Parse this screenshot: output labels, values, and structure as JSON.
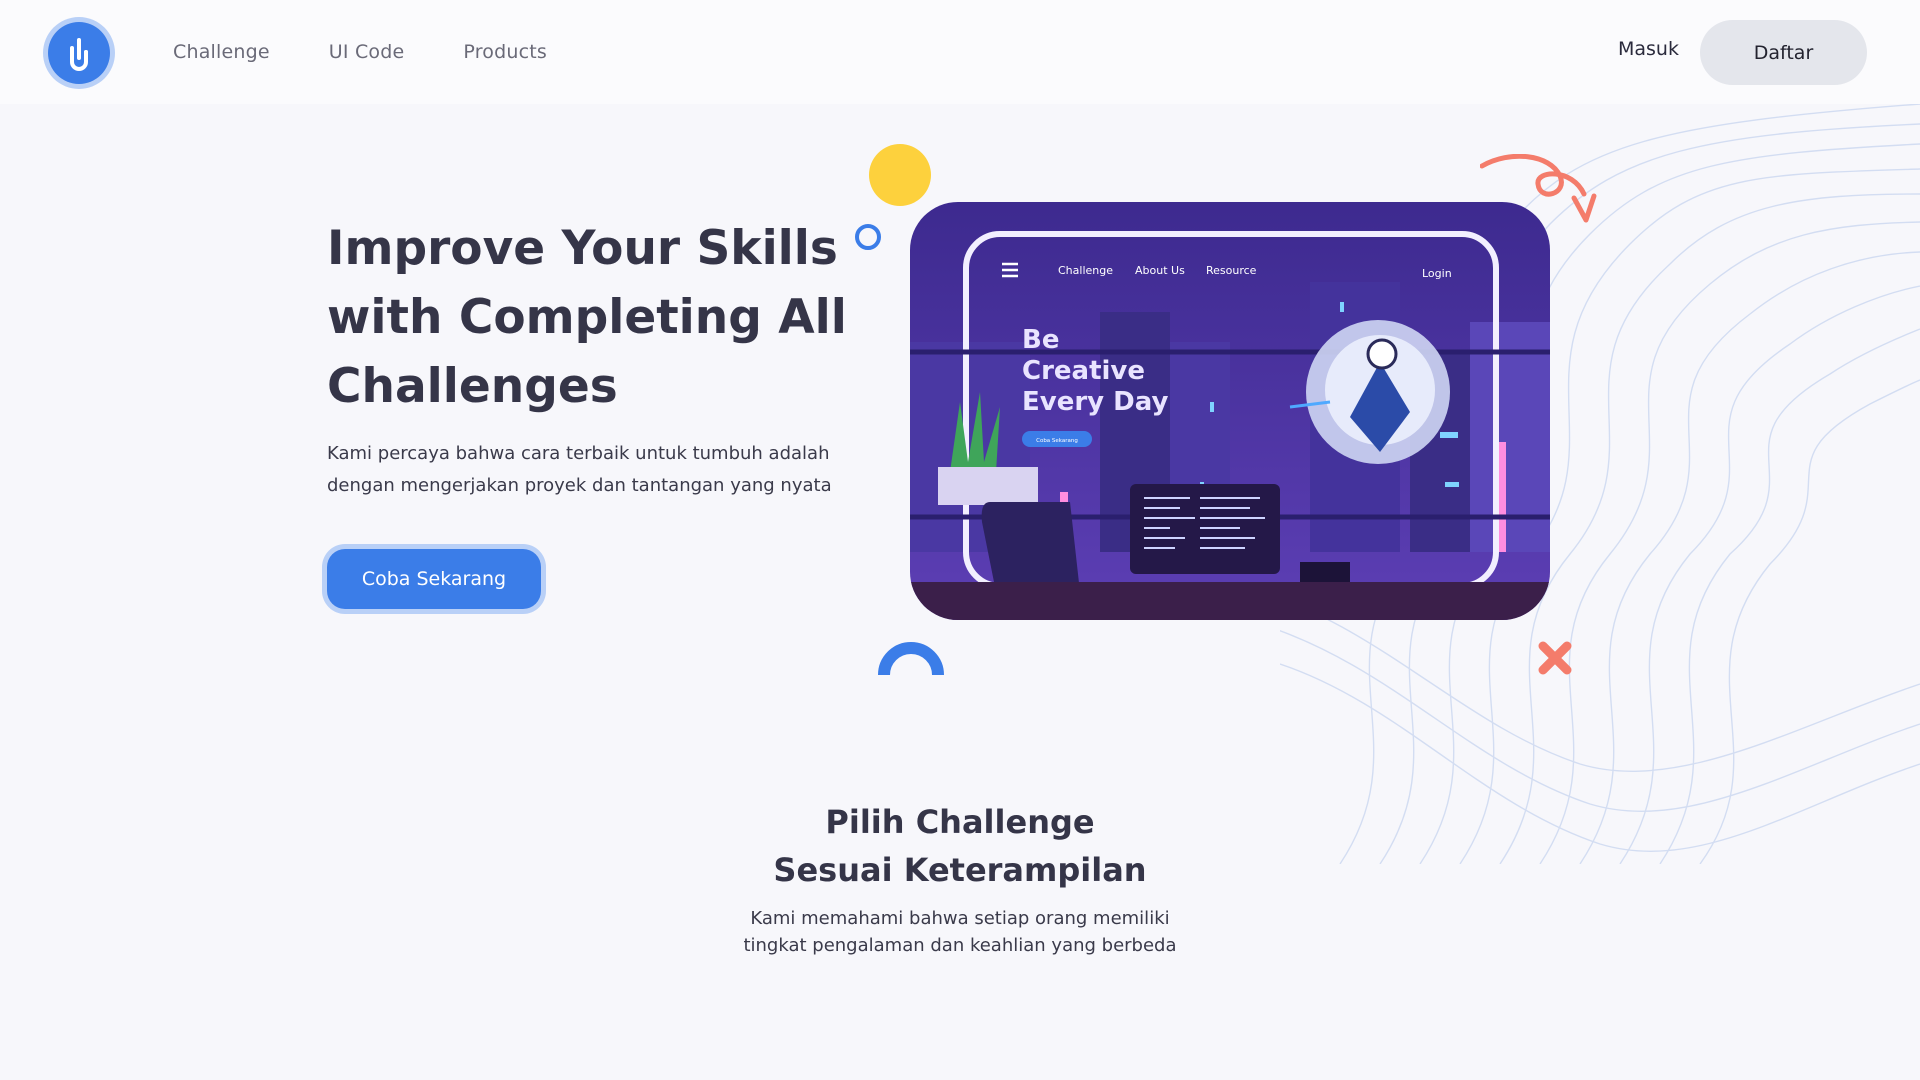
{
  "brand": {
    "logo_icon": "hand-pointer-icon",
    "accent": "#3b7de8"
  },
  "nav": {
    "links": [
      "Challenge",
      "UI Code",
      "Products"
    ],
    "login_label": "Masuk",
    "register_label": "Daftar"
  },
  "hero": {
    "title_lines": [
      "Improve Your Skills",
      "with Completing All",
      "Challenges"
    ],
    "subtitle_lines": [
      "Kami percaya bahwa cara terbaik untuk tumbuh adalah",
      "dengan mengerjakan proyek dan tantangan yang nyata"
    ],
    "cta_label": "Coba Sekarang"
  },
  "illustration": {
    "nav_items": [
      "Challenge",
      "About Us",
      "Resource"
    ],
    "login": "Login",
    "headline_lines": [
      "Be",
      "Creative",
      "Every Day"
    ],
    "button": "Coba Sekarang"
  },
  "section": {
    "title_lines": [
      "Pilih Challenge",
      "Sesuai Keterampilan"
    ],
    "subtitle_lines": [
      "Kami memahami bahwa setiap orang memiliki",
      "tingkat pengalaman dan keahlian yang berbeda"
    ]
  }
}
